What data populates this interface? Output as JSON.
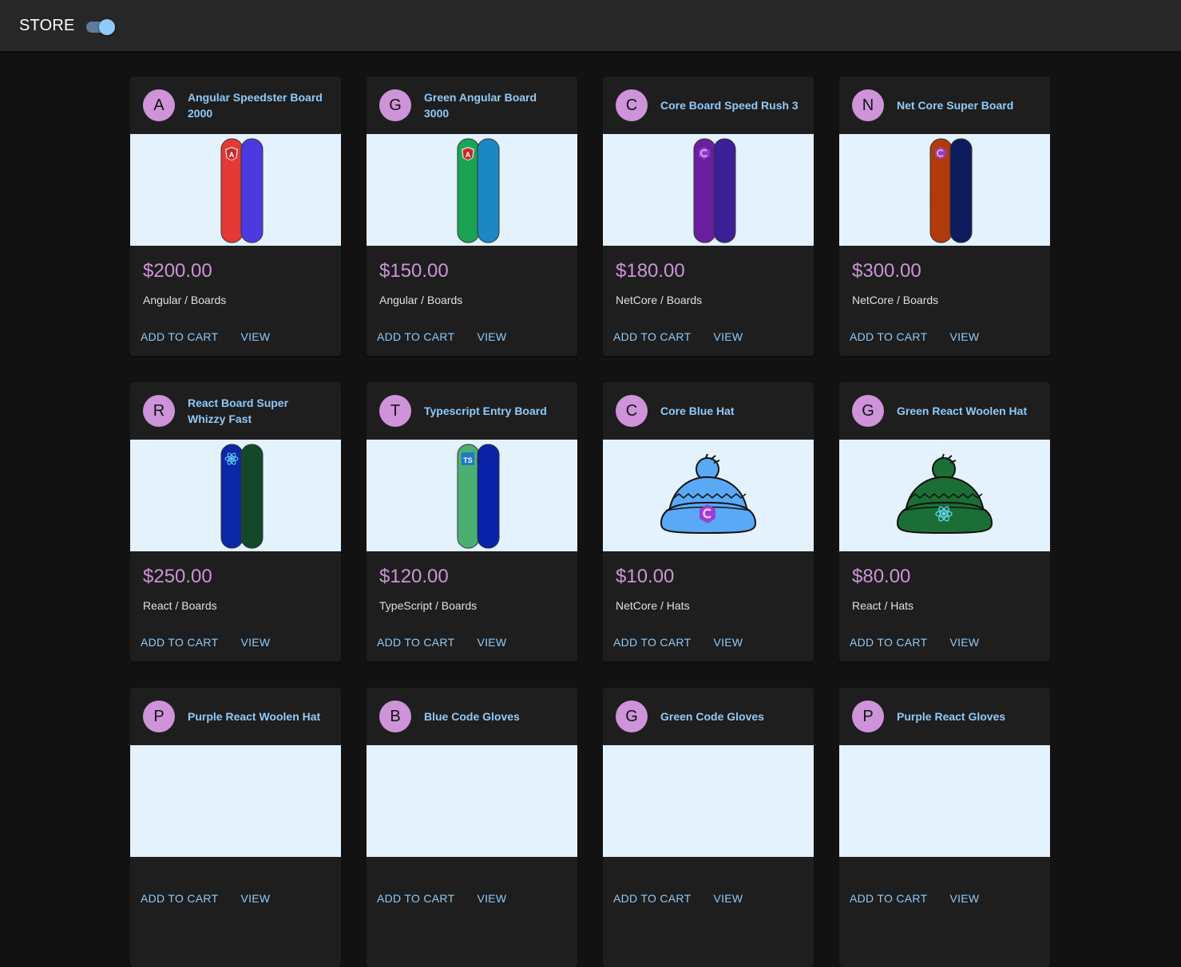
{
  "header": {
    "brand": "STORE",
    "theme_toggle_on": true
  },
  "products": [
    {
      "avatar": "A",
      "title": "Angular Speedster Board 2000",
      "price": "$200.00",
      "category": "Angular / Boards",
      "image": "board",
      "colors": [
        "#e53935",
        "#4a3ae0"
      ],
      "logo": "angular-logo-icon"
    },
    {
      "avatar": "G",
      "title": "Green Angular Board 3000",
      "price": "$150.00",
      "category": "Angular / Boards",
      "image": "board",
      "colors": [
        "#1aa353",
        "#1b88c4"
      ],
      "logo": "angular-logo-icon"
    },
    {
      "avatar": "C",
      "title": "Core Board Speed Rush 3",
      "price": "$180.00",
      "category": "NetCore / Boards",
      "image": "board",
      "colors": [
        "#6a1fa0",
        "#3b1f96"
      ],
      "logo": "netcore-logo-icon"
    },
    {
      "avatar": "N",
      "title": "Net Core Super Board",
      "price": "$300.00",
      "category": "NetCore / Boards",
      "image": "board",
      "colors": [
        "#b13a0c",
        "#0d1b5c"
      ],
      "logo": "netcore-logo-icon"
    },
    {
      "avatar": "R",
      "title": "React Board Super Whizzy Fast",
      "price": "$250.00",
      "category": "React / Boards",
      "image": "board",
      "colors": [
        "#0a27a6",
        "#15472b"
      ],
      "logo": "react-logo-icon"
    },
    {
      "avatar": "T",
      "title": "Typescript Entry Board",
      "price": "$120.00",
      "category": "TypeScript / Boards",
      "image": "board",
      "colors": [
        "#4caf72",
        "#0a22a8"
      ],
      "logo": "typescript-logo-icon"
    },
    {
      "avatar": "C",
      "title": "Core Blue Hat",
      "price": "$10.00",
      "category": "NetCore / Hats",
      "image": "hat",
      "colors": [
        "#5aa9f7",
        "#5aa9f7"
      ],
      "logo": "netcore-logo-icon"
    },
    {
      "avatar": "G",
      "title": "Green React Woolen Hat",
      "price": "$80.00",
      "category": "React / Hats",
      "image": "hat",
      "colors": [
        "#1b6e35",
        "#1b6e35"
      ],
      "logo": "react-logo-icon"
    },
    {
      "avatar": "P",
      "title": "Purple React Woolen Hat",
      "price": "",
      "category": "",
      "image": "none",
      "colors": [],
      "logo": ""
    },
    {
      "avatar": "B",
      "title": "Blue Code Gloves",
      "price": "",
      "category": "",
      "image": "none",
      "colors": [],
      "logo": ""
    },
    {
      "avatar": "G",
      "title": "Green Code Gloves",
      "price": "",
      "category": "",
      "image": "none",
      "colors": [],
      "logo": ""
    },
    {
      "avatar": "P",
      "title": "Purple React Gloves",
      "price": "",
      "category": "",
      "image": "none",
      "colors": [],
      "logo": ""
    }
  ],
  "actions": {
    "add_to_cart": "ADD TO CART",
    "view": "VIEW"
  }
}
